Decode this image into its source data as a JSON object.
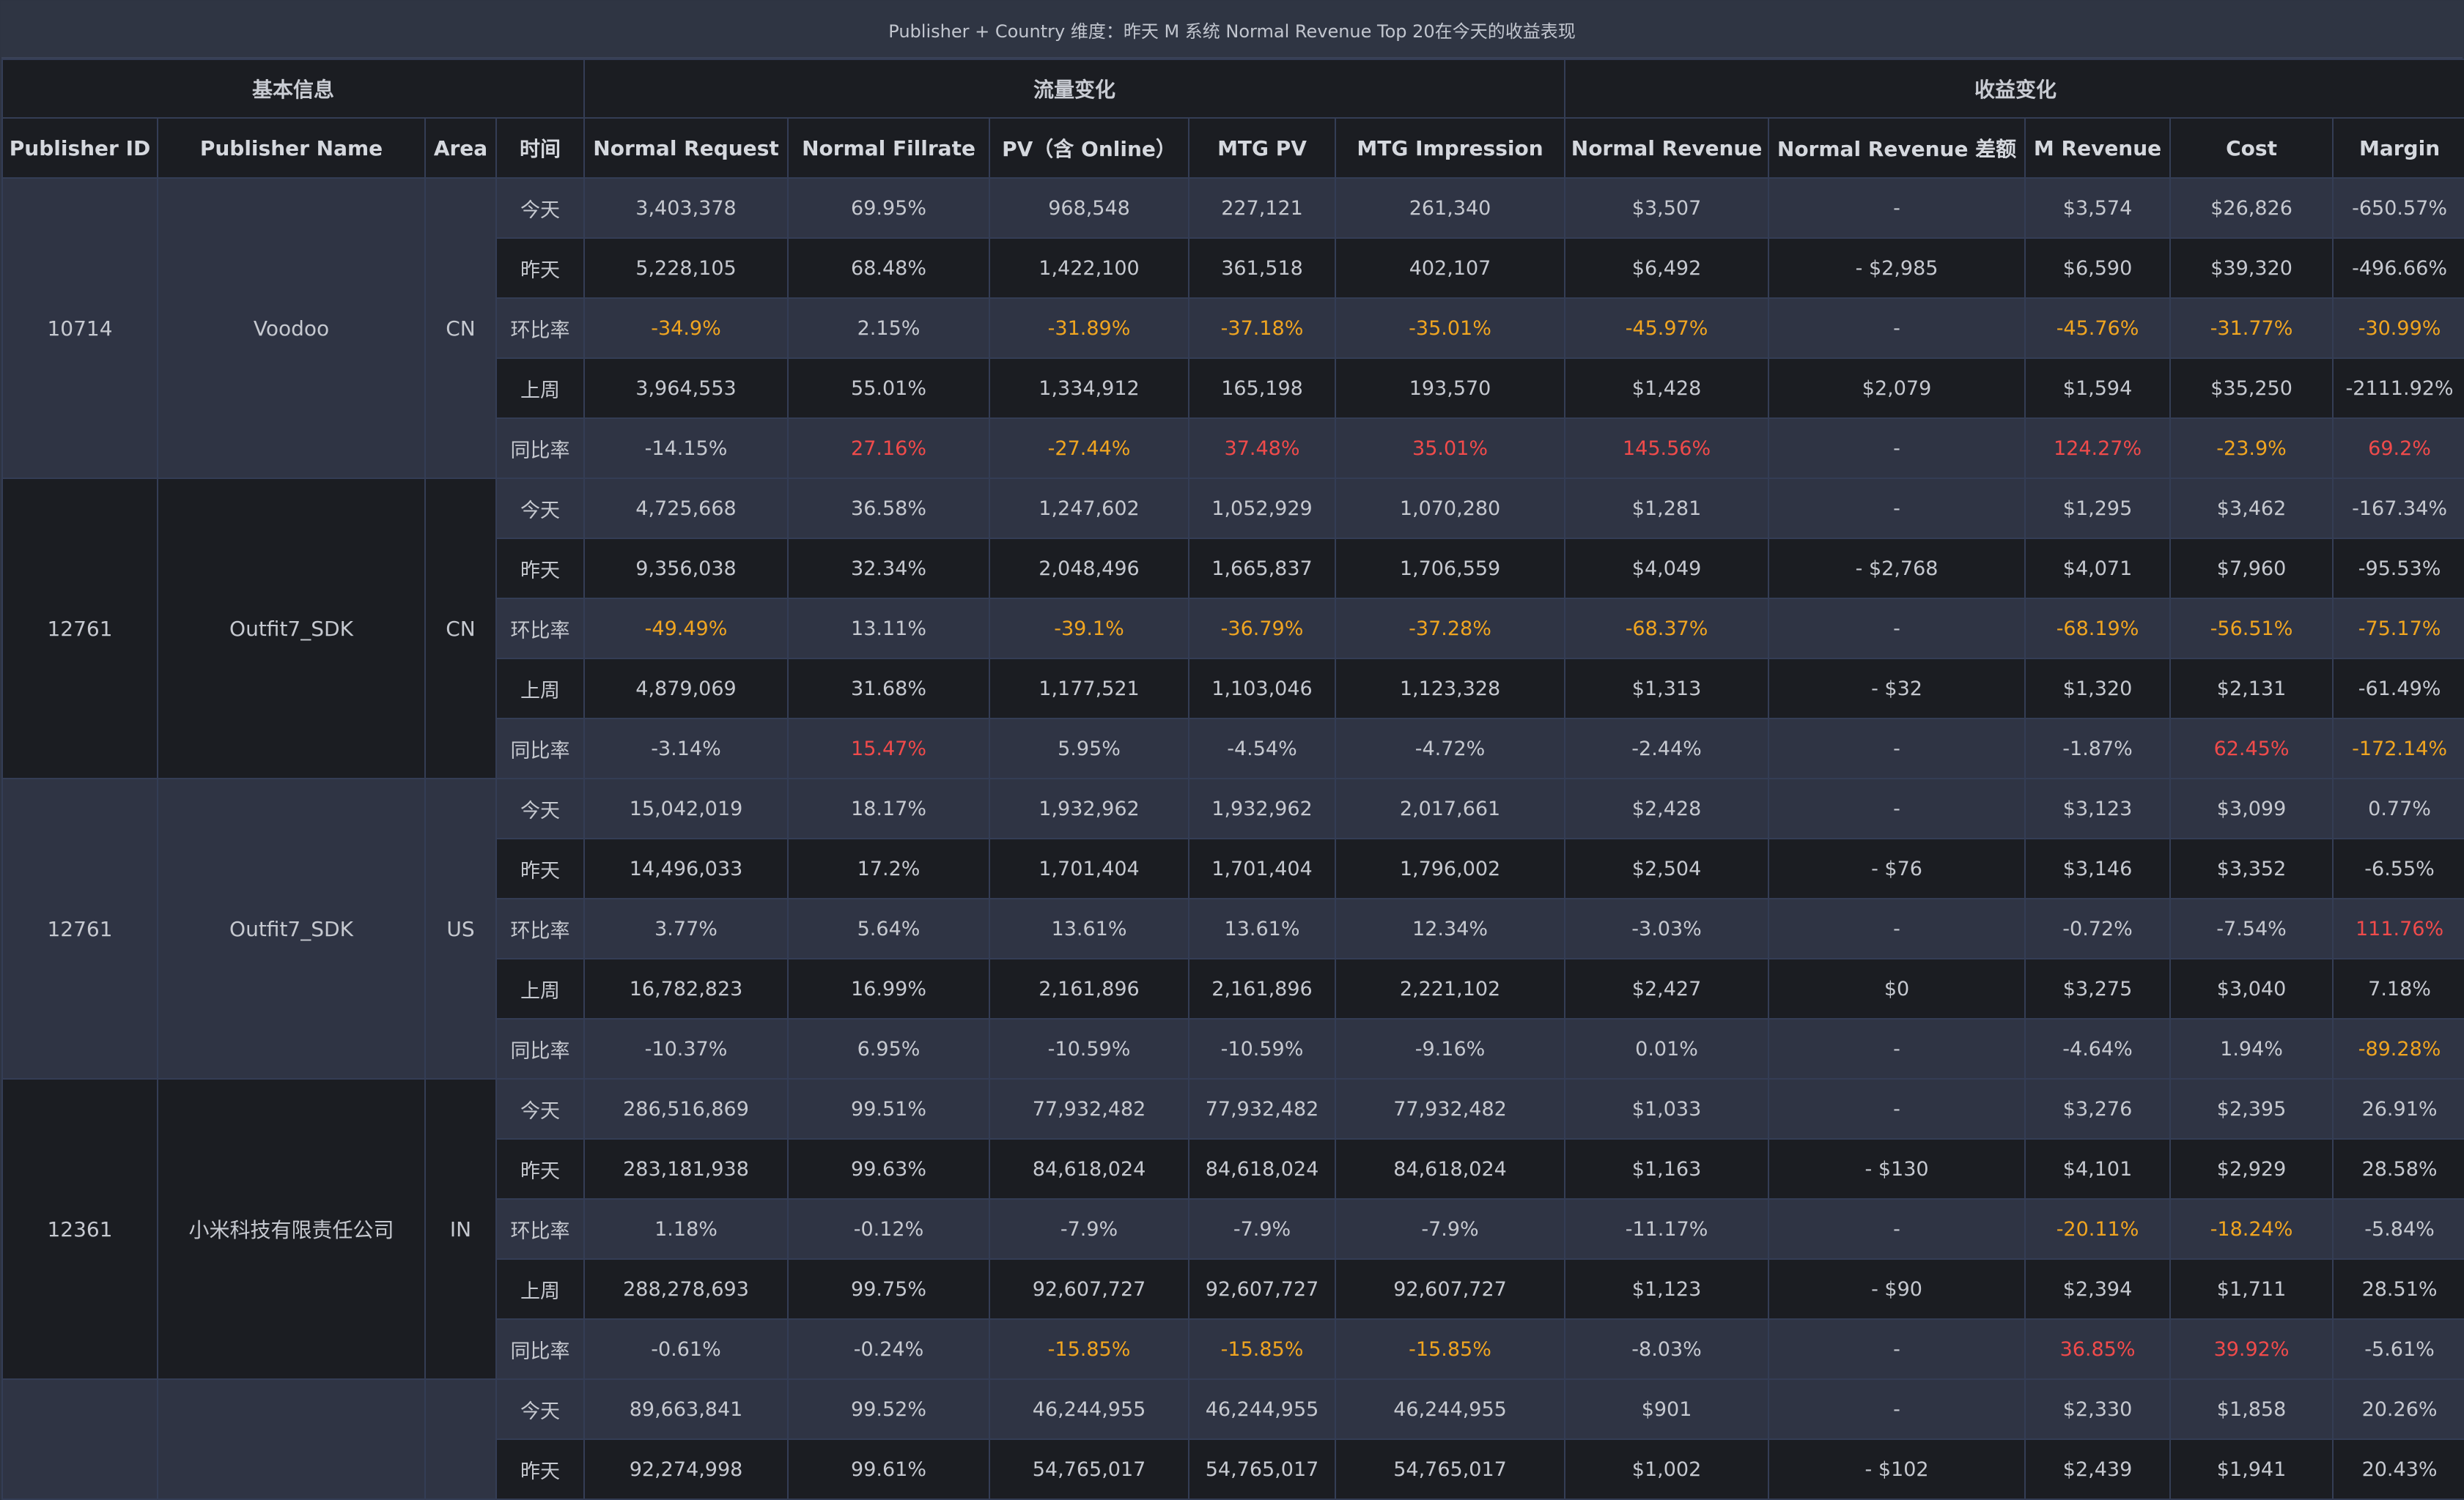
{
  "title": "Publisher + Country 维度：昨天 M 系统 Normal Revenue Top 20在今天的收益表现",
  "groups": {
    "basic": "基本信息",
    "traffic": "流量变化",
    "revenue": "收益变化"
  },
  "columns": [
    "Publisher ID",
    "Publisher Name",
    "Area",
    "时间",
    "Normal Request",
    "Normal Fillrate",
    "PV（含 Online）",
    "MTG PV",
    "MTG Impression",
    "Normal Revenue",
    "Normal Revenue 差额",
    "M Revenue",
    "Cost",
    "Margin"
  ],
  "colors": {
    "header_bg": "#2f3543",
    "row_shade": "#2f3444",
    "row_plain": "#1b1d22",
    "grid": "#343d55",
    "highlight_orange": "#f0a521",
    "highlight_red": "#f04b4b"
  },
  "publishers": [
    {
      "id": "10714",
      "name": "Voodoo",
      "area": "CN",
      "rows": [
        {
          "period": "今天",
          "cells": [
            "3,403,378",
            "69.95%",
            "968,548",
            "227,121",
            "261,340",
            "$3,507",
            "-",
            "$3,574",
            "$26,826",
            "-650.57%"
          ],
          "hl": [
            "",
            "",
            "",
            "",
            "",
            "",
            "",
            "",
            "",
            ""
          ]
        },
        {
          "period": "昨天",
          "cells": [
            "5,228,105",
            "68.48%",
            "1,422,100",
            "361,518",
            "402,107",
            "$6,492",
            "- $2,985",
            "$6,590",
            "$39,320",
            "-496.66%"
          ],
          "hl": [
            "",
            "",
            "",
            "",
            "",
            "",
            "",
            "",
            "",
            ""
          ]
        },
        {
          "period": "环比率",
          "cells": [
            "-34.9%",
            "2.15%",
            "-31.89%",
            "-37.18%",
            "-35.01%",
            "-45.97%",
            "-",
            "-45.76%",
            "-31.77%",
            "-30.99%"
          ],
          "hl": [
            "o",
            "",
            "o",
            "o",
            "o",
            "o",
            "",
            "o",
            "o",
            "o"
          ]
        },
        {
          "period": "上周",
          "cells": [
            "3,964,553",
            "55.01%",
            "1,334,912",
            "165,198",
            "193,570",
            "$1,428",
            "$2,079",
            "$1,594",
            "$35,250",
            "-2111.92%"
          ],
          "hl": [
            "",
            "",
            "",
            "",
            "",
            "",
            "",
            "",
            "",
            ""
          ]
        },
        {
          "period": "同比率",
          "cells": [
            "-14.15%",
            "27.16%",
            "-27.44%",
            "37.48%",
            "35.01%",
            "145.56%",
            "-",
            "124.27%",
            "-23.9%",
            "69.2%"
          ],
          "hl": [
            "",
            "r",
            "o",
            "r",
            "r",
            "r",
            "",
            "r",
            "o",
            "r"
          ]
        }
      ]
    },
    {
      "id": "12761",
      "name": "Outfit7_SDK",
      "area": "CN",
      "rows": [
        {
          "period": "今天",
          "cells": [
            "4,725,668",
            "36.58%",
            "1,247,602",
            "1,052,929",
            "1,070,280",
            "$1,281",
            "-",
            "$1,295",
            "$3,462",
            "-167.34%"
          ],
          "hl": [
            "",
            "",
            "",
            "",
            "",
            "",
            "",
            "",
            "",
            ""
          ]
        },
        {
          "period": "昨天",
          "cells": [
            "9,356,038",
            "32.34%",
            "2,048,496",
            "1,665,837",
            "1,706,559",
            "$4,049",
            "- $2,768",
            "$4,071",
            "$7,960",
            "-95.53%"
          ],
          "hl": [
            "",
            "",
            "",
            "",
            "",
            "",
            "",
            "",
            "",
            ""
          ]
        },
        {
          "period": "环比率",
          "cells": [
            "-49.49%",
            "13.11%",
            "-39.1%",
            "-36.79%",
            "-37.28%",
            "-68.37%",
            "-",
            "-68.19%",
            "-56.51%",
            "-75.17%"
          ],
          "hl": [
            "o",
            "",
            "o",
            "o",
            "o",
            "o",
            "",
            "o",
            "o",
            "o"
          ]
        },
        {
          "period": "上周",
          "cells": [
            "4,879,069",
            "31.68%",
            "1,177,521",
            "1,103,046",
            "1,123,328",
            "$1,313",
            "- $32",
            "$1,320",
            "$2,131",
            "-61.49%"
          ],
          "hl": [
            "",
            "",
            "",
            "",
            "",
            "",
            "",
            "",
            "",
            ""
          ]
        },
        {
          "period": "同比率",
          "cells": [
            "-3.14%",
            "15.47%",
            "5.95%",
            "-4.54%",
            "-4.72%",
            "-2.44%",
            "-",
            "-1.87%",
            "62.45%",
            "-172.14%"
          ],
          "hl": [
            "",
            "r",
            "",
            "",
            "",
            "",
            "",
            "",
            "r",
            "o"
          ]
        }
      ]
    },
    {
      "id": "12761",
      "name": "Outfit7_SDK",
      "area": "US",
      "rows": [
        {
          "period": "今天",
          "cells": [
            "15,042,019",
            "18.17%",
            "1,932,962",
            "1,932,962",
            "2,017,661",
            "$2,428",
            "-",
            "$3,123",
            "$3,099",
            "0.77%"
          ],
          "hl": [
            "",
            "",
            "",
            "",
            "",
            "",
            "",
            "",
            "",
            ""
          ]
        },
        {
          "period": "昨天",
          "cells": [
            "14,496,033",
            "17.2%",
            "1,701,404",
            "1,701,404",
            "1,796,002",
            "$2,504",
            "- $76",
            "$3,146",
            "$3,352",
            "-6.55%"
          ],
          "hl": [
            "",
            "",
            "",
            "",
            "",
            "",
            "",
            "",
            "",
            ""
          ]
        },
        {
          "period": "环比率",
          "cells": [
            "3.77%",
            "5.64%",
            "13.61%",
            "13.61%",
            "12.34%",
            "-3.03%",
            "-",
            "-0.72%",
            "-7.54%",
            "111.76%"
          ],
          "hl": [
            "",
            "",
            "",
            "",
            "",
            "",
            "",
            "",
            "",
            "r"
          ]
        },
        {
          "period": "上周",
          "cells": [
            "16,782,823",
            "16.99%",
            "2,161,896",
            "2,161,896",
            "2,221,102",
            "$2,427",
            "$0",
            "$3,275",
            "$3,040",
            "7.18%"
          ],
          "hl": [
            "",
            "",
            "",
            "",
            "",
            "",
            "",
            "",
            "",
            ""
          ]
        },
        {
          "period": "同比率",
          "cells": [
            "-10.37%",
            "6.95%",
            "-10.59%",
            "-10.59%",
            "-9.16%",
            "0.01%",
            "-",
            "-4.64%",
            "1.94%",
            "-89.28%"
          ],
          "hl": [
            "",
            "",
            "",
            "",
            "",
            "",
            "",
            "",
            "",
            "o"
          ]
        }
      ]
    },
    {
      "id": "12361",
      "name": "小米科技有限责任公司",
      "area": "IN",
      "rows": [
        {
          "period": "今天",
          "cells": [
            "286,516,869",
            "99.51%",
            "77,932,482",
            "77,932,482",
            "77,932,482",
            "$1,033",
            "-",
            "$3,276",
            "$2,395",
            "26.91%"
          ],
          "hl": [
            "",
            "",
            "",
            "",
            "",
            "",
            "",
            "",
            "",
            ""
          ]
        },
        {
          "period": "昨天",
          "cells": [
            "283,181,938",
            "99.63%",
            "84,618,024",
            "84,618,024",
            "84,618,024",
            "$1,163",
            "- $130",
            "$4,101",
            "$2,929",
            "28.58%"
          ],
          "hl": [
            "",
            "",
            "",
            "",
            "",
            "",
            "",
            "",
            "",
            ""
          ]
        },
        {
          "period": "环比率",
          "cells": [
            "1.18%",
            "-0.12%",
            "-7.9%",
            "-7.9%",
            "-7.9%",
            "-11.17%",
            "-",
            "-20.11%",
            "-18.24%",
            "-5.84%"
          ],
          "hl": [
            "",
            "",
            "",
            "",
            "",
            "",
            "",
            "o",
            "o",
            ""
          ]
        },
        {
          "period": "上周",
          "cells": [
            "288,278,693",
            "99.75%",
            "92,607,727",
            "92,607,727",
            "92,607,727",
            "$1,123",
            "- $90",
            "$2,394",
            "$1,711",
            "28.51%"
          ],
          "hl": [
            "",
            "",
            "",
            "",
            "",
            "",
            "",
            "",
            "",
            ""
          ]
        },
        {
          "period": "同比率",
          "cells": [
            "-0.61%",
            "-0.24%",
            "-15.85%",
            "-15.85%",
            "-15.85%",
            "-8.03%",
            "-",
            "36.85%",
            "39.92%",
            "-5.61%"
          ],
          "hl": [
            "",
            "",
            "o",
            "o",
            "o",
            "",
            "",
            "r",
            "r",
            ""
          ]
        }
      ]
    },
    {
      "id": "",
      "name": "",
      "area": "",
      "rows": [
        {
          "period": "今天",
          "cells": [
            "89,663,841",
            "99.52%",
            "46,244,955",
            "46,244,955",
            "46,244,955",
            "$901",
            "-",
            "$2,330",
            "$1,858",
            "20.26%"
          ],
          "hl": [
            "",
            "",
            "",
            "",
            "",
            "",
            "",
            "",
            "",
            ""
          ]
        },
        {
          "period": "昨天",
          "cells": [
            "92,274,998",
            "99.61%",
            "54,765,017",
            "54,765,017",
            "54,765,017",
            "$1,002",
            "- $102",
            "$2,439",
            "$1,941",
            "20.43%"
          ],
          "hl": [
            "",
            "",
            "",
            "",
            "",
            "",
            "",
            "",
            "",
            ""
          ]
        }
      ]
    }
  ]
}
